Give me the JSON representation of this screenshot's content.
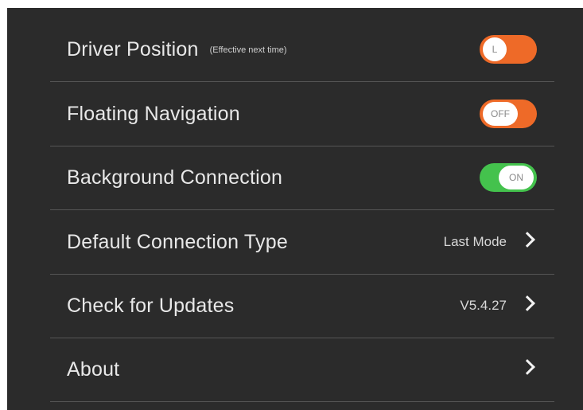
{
  "settings": {
    "driver_position": {
      "label": "Driver Position",
      "note": "(Effective next time)",
      "toggle_text": "L",
      "toggle_color": "#ee6a28"
    },
    "floating_navigation": {
      "label": "Floating Navigation",
      "toggle_text": "OFF",
      "toggle_color": "#ee6a28"
    },
    "background_connection": {
      "label": "Background Connection",
      "toggle_text": "ON",
      "toggle_color": "#44c24d"
    },
    "default_connection_type": {
      "label": "Default Connection Type",
      "value": "Last Mode",
      "icon": "chevron-right-icon"
    },
    "check_for_updates": {
      "label": "Check for Updates",
      "value": "V5.4.27",
      "icon": "chevron-right-icon"
    },
    "about": {
      "label": "About",
      "icon": "chevron-right-icon"
    }
  },
  "colors": {
    "panel_background": "#2b2b2b",
    "divider": "#555555",
    "text": "#e8e8e8"
  }
}
